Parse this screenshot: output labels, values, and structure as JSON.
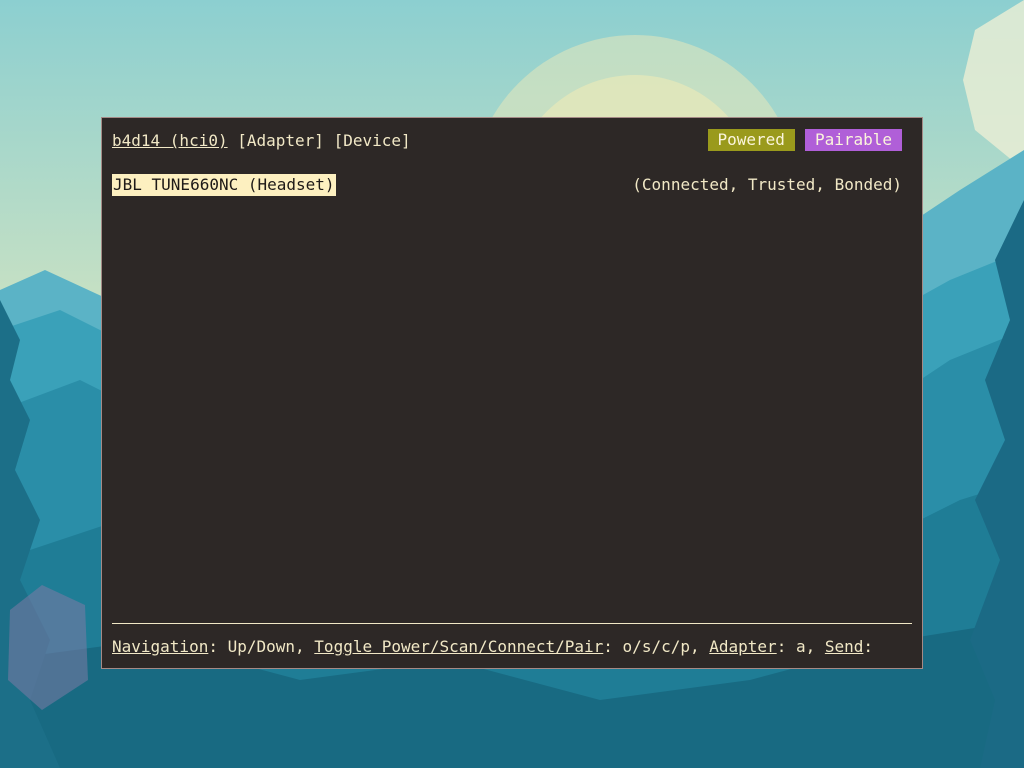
{
  "terminal": {
    "header": {
      "adapter_name": "b4d14 (hci0)",
      "adapter_tab": "[Adapter]",
      "device_tab": "[Device]"
    },
    "badges": {
      "powered": "Powered",
      "pairable": "Pairable"
    },
    "devices": [
      {
        "name": "JBL TUNE660NC (Headset)",
        "status": "(Connected, Trusted, Bonded)",
        "selected": true
      }
    ],
    "footer": {
      "nav_label": "Navigation",
      "nav_value": ": Up/Down, ",
      "toggle_label": "Toggle Power/Scan/Connect/Pair",
      "toggle_value": ": o/s/c/p, ",
      "adapter_label": "Adapter",
      "adapter_value": ": a, ",
      "send_label": "Send",
      "send_value": ":"
    }
  },
  "colors": {
    "terminal_bg": "#2d2826",
    "text": "#f1e8c6",
    "powered_badge": "#9a9a1c",
    "pairable_badge": "#b05fd8",
    "selection_bg": "#fdf0c0"
  }
}
